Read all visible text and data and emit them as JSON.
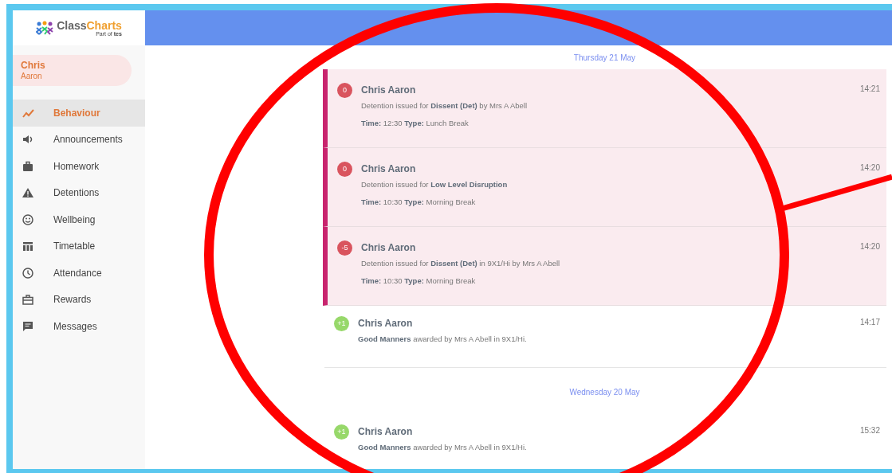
{
  "brand": {
    "first": "Class",
    "second": "Charts",
    "tagline": "Part of **tes**"
  },
  "profile": {
    "first_name": "Chris",
    "last_name": "Aaron"
  },
  "sidebar": {
    "items": [
      {
        "label": "Behaviour",
        "selected": true
      },
      {
        "label": "Announcements",
        "selected": false
      },
      {
        "label": "Homework",
        "selected": false
      },
      {
        "label": "Detentions",
        "selected": false
      },
      {
        "label": "Wellbeing",
        "selected": false
      },
      {
        "label": "Timetable",
        "selected": false
      },
      {
        "label": "Attendance",
        "selected": false
      },
      {
        "label": "Rewards",
        "selected": false
      },
      {
        "label": "Messages",
        "selected": false
      }
    ]
  },
  "days": [
    {
      "date": "Thursday 21 May",
      "events": [
        {
          "kind": "detention",
          "score": "0",
          "name": "Chris Aaron",
          "time": "14:21",
          "description": "Detention issued for **Dissent (Det)** by Mrs A Abell",
          "details": "**Time:** 12:30 **Type:** Lunch Break"
        },
        {
          "kind": "detention",
          "score": "0",
          "name": "Chris Aaron",
          "time": "14:20",
          "description": "Detention issued for **Low Level Disruption**",
          "details": "**Time:** 10:30 **Type:** Morning Break"
        },
        {
          "kind": "detention",
          "score": "-5",
          "name": "Chris Aaron",
          "time": "14:20",
          "description": "Detention issued for **Dissent (Det)** in 9X1/Hi by Mrs A Abell",
          "details": "**Time:** 10:30 **Type:** Morning Break"
        },
        {
          "kind": "award",
          "score": "+1",
          "name": "Chris Aaron",
          "time": "14:17",
          "description": "**Good Manners** awarded by Mrs A Abell in 9X1/Hi."
        }
      ]
    },
    {
      "date": "Wednesday 20 May",
      "events": [
        {
          "kind": "award",
          "score": "+1",
          "name": "Chris Aaron",
          "time": "15:32",
          "description": "**Good Manners** awarded by Mrs A Abell in 9X1/Hi."
        }
      ]
    }
  ]
}
